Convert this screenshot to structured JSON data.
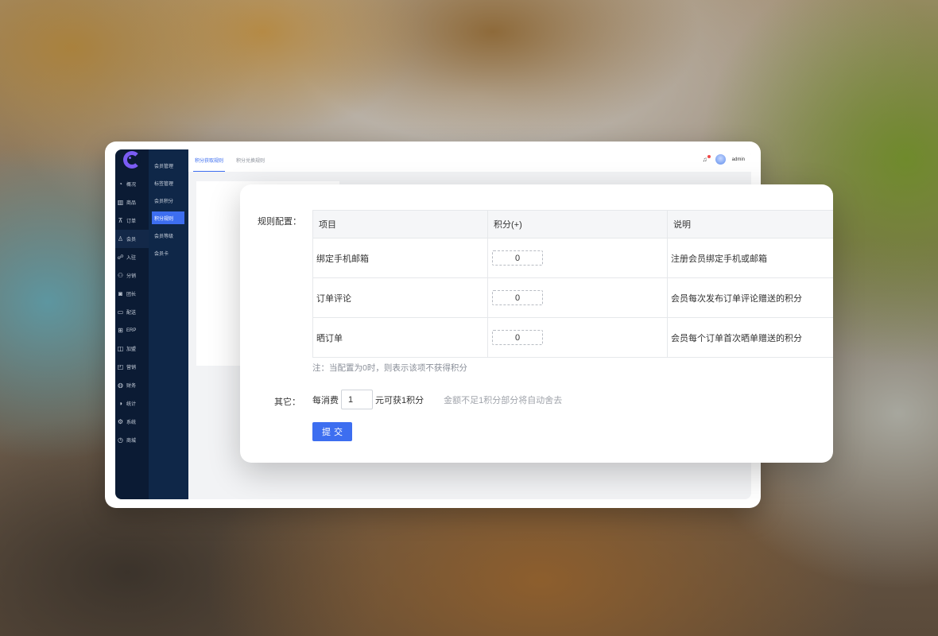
{
  "app": {
    "sidebar": {
      "items": [
        {
          "label": "概况",
          "icon": "dashboard-icon"
        },
        {
          "label": "商品",
          "icon": "goods-icon"
        },
        {
          "label": "订单",
          "icon": "cart-icon"
        },
        {
          "label": "会员",
          "icon": "user-icon"
        },
        {
          "label": "入驻",
          "icon": "settle-icon"
        },
        {
          "label": "分销",
          "icon": "distribution-icon"
        },
        {
          "label": "团长",
          "icon": "leader-icon"
        },
        {
          "label": "配送",
          "icon": "delivery-icon"
        },
        {
          "label": "ERP",
          "icon": "erp-icon"
        },
        {
          "label": "加盟",
          "icon": "franchise-icon"
        },
        {
          "label": "营销",
          "icon": "marketing-icon"
        },
        {
          "label": "财务",
          "icon": "finance-icon"
        },
        {
          "label": "统计",
          "icon": "chart-icon"
        },
        {
          "label": "系统",
          "icon": "gear-icon"
        },
        {
          "label": "商城",
          "icon": "store-icon"
        }
      ],
      "active_index": 3
    },
    "subnav": {
      "items": [
        "会员管理",
        "标签管理",
        "会员积分",
        "积分规则",
        "会员等级",
        "会员卡"
      ],
      "active_index": 3
    },
    "tabs": [
      "积分获取规则",
      "积分兑换规则"
    ],
    "active_tab": 0,
    "user": {
      "name": "admin"
    }
  },
  "panel": {
    "rule_label": "规则配置：",
    "table": {
      "headers": [
        "项目",
        "积分(+)",
        "说明"
      ],
      "rows": [
        {
          "item": "绑定手机邮箱",
          "points": "0",
          "desc": "注册会员绑定手机或邮箱"
        },
        {
          "item": "订单评论",
          "points": "0",
          "desc": "会员每次发布订单评论赠送的积分"
        },
        {
          "item": "晒订单",
          "points": "0",
          "desc": "会员每个订单首次晒单赠送的积分"
        }
      ]
    },
    "note": "注：当配置为0时，则表示该项不获得积分",
    "other": {
      "label": "其它：",
      "prefix": "每消费",
      "value": "1",
      "suffix": "元可获1积分",
      "hint": "金额不足1积分部分将自动舍去"
    },
    "submit_label": "提交"
  },
  "colors": {
    "accent": "#3d6ef0",
    "sidebar_bg": "#0b1b34",
    "subnav_bg": "#0f2748"
  }
}
